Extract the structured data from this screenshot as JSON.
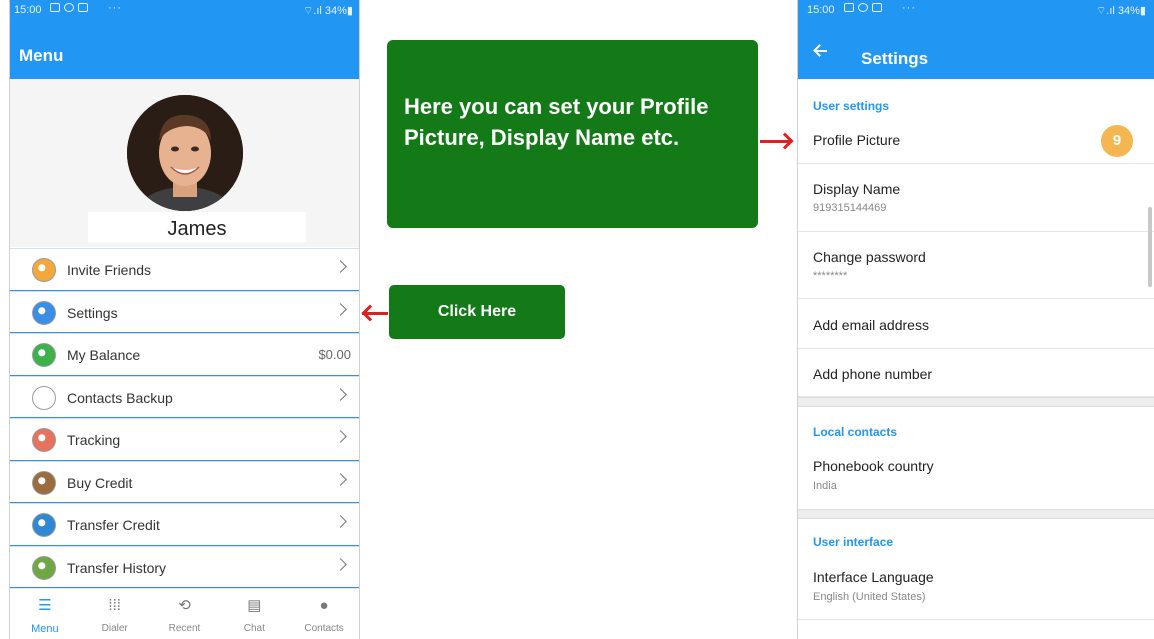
{
  "left_phone": {
    "status": {
      "time": "15:00",
      "dots": "···",
      "right": "⌔.ıl 34%▮"
    },
    "appbar_title": "Menu",
    "user_name": "James",
    "menu_items": [
      {
        "label": "Invite Friends",
        "icon": "invite-friends-icon",
        "color": "#f4a83c",
        "trailing": "chevron"
      },
      {
        "label": "Settings",
        "icon": "settings-icon",
        "color": "#3b8ee6",
        "trailing": "chevron"
      },
      {
        "label": "My Balance",
        "icon": "balance-icon",
        "color": "#3db24a",
        "trailing": "value",
        "value": "$0.00"
      },
      {
        "label": "Contacts Backup",
        "icon": "cloud-backup-icon",
        "color": "#ffffff",
        "trailing": "chevron"
      },
      {
        "label": "Tracking",
        "icon": "tracking-icon",
        "color": "#e7735f",
        "trailing": "chevron"
      },
      {
        "label": "Buy Credit",
        "icon": "buy-credit-icon",
        "color": "#9a6b3c",
        "trailing": "chevron"
      },
      {
        "label": "Transfer Credit",
        "icon": "transfer-credit-icon",
        "color": "#2f88d4",
        "trailing": "chevron"
      },
      {
        "label": "Transfer History",
        "icon": "transfer-history-icon",
        "color": "#6ea845",
        "trailing": "chevron"
      }
    ],
    "bottom_nav": [
      {
        "label": "Menu",
        "icon": "☰",
        "active": true
      },
      {
        "label": "Dialer",
        "icon": "⁞⁞⁞",
        "active": false
      },
      {
        "label": "Recent",
        "icon": "⟲",
        "active": false
      },
      {
        "label": "Chat",
        "icon": "▤",
        "active": false
      },
      {
        "label": "Contacts",
        "icon": "●",
        "active": false
      }
    ]
  },
  "callouts": {
    "profile_text": "Here you can set your Profile Picture, Display Name etc.",
    "click_text": "Click Here"
  },
  "right_phone": {
    "status": {
      "time": "15:00",
      "dots": "···",
      "right": "⌔.ıl 34%▮"
    },
    "appbar_title": "Settings",
    "sections": {
      "user_settings": "User settings",
      "local_contacts": "Local contacts",
      "user_interface": "User interface"
    },
    "rows": {
      "profile_picture": "Profile Picture",
      "profile_badge": "9",
      "display_name": "Display Name",
      "display_name_value": "919315144469",
      "change_password": "Change password",
      "password_value": "********",
      "add_email": "Add email address",
      "add_phone": "Add phone number",
      "phonebook_country": "Phonebook country",
      "phonebook_country_value": "India",
      "interface_language": "Interface Language",
      "interface_language_value": "English (United States)"
    }
  },
  "colors": {
    "primary": "#2196f3",
    "callout_green": "#147a18",
    "arrow_red": "#e02020",
    "badge": "#f3b651"
  }
}
